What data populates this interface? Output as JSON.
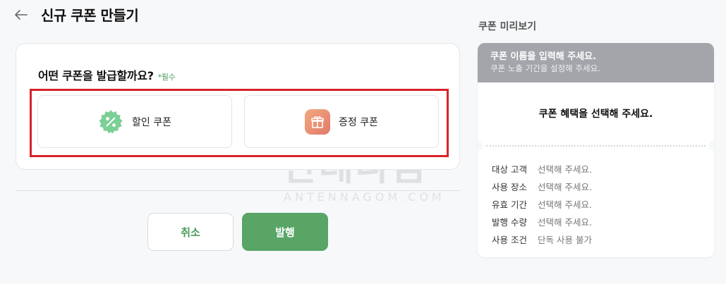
{
  "header": {
    "back_icon": "arrow-left-icon",
    "title": "신규 쿠폰 만들기"
  },
  "coupon_type": {
    "question": "어떤 쿠폰을 발급할까요?",
    "required": "*필수",
    "options": [
      {
        "label": "할인 쿠폰",
        "icon": "percent-badge-icon",
        "color": "#7ccf96"
      },
      {
        "label": "증정 쿠폰",
        "icon": "gift-icon",
        "color": "#e9896f"
      }
    ]
  },
  "actions": {
    "cancel": "취소",
    "issue": "발행"
  },
  "watermark": {
    "text": "안테나곰",
    "sub": "ANTENNAGOM.COM"
  },
  "preview": {
    "title": "쿠폰 미리보기",
    "name_placeholder": "쿠폰 이름을 입력해 주세요.",
    "period_placeholder": "쿠폰 노출 기간을 설정해 주세요.",
    "benefit_placeholder": "쿠폰 혜택을 선택해 주세요.",
    "details": [
      {
        "key": "대상 고객",
        "value": "선택해 주세요."
      },
      {
        "key": "사용 장소",
        "value": "선택해 주세요."
      },
      {
        "key": "유효 기간",
        "value": "선택해 주세요."
      },
      {
        "key": "발행 수량",
        "value": "선택해 주세요."
      },
      {
        "key": "사용 조건",
        "value": "단독 사용 불가"
      }
    ]
  },
  "colors": {
    "accent_green": "#58a566",
    "highlight_red": "#d9222a",
    "preview_header": "#a3a5aa"
  }
}
